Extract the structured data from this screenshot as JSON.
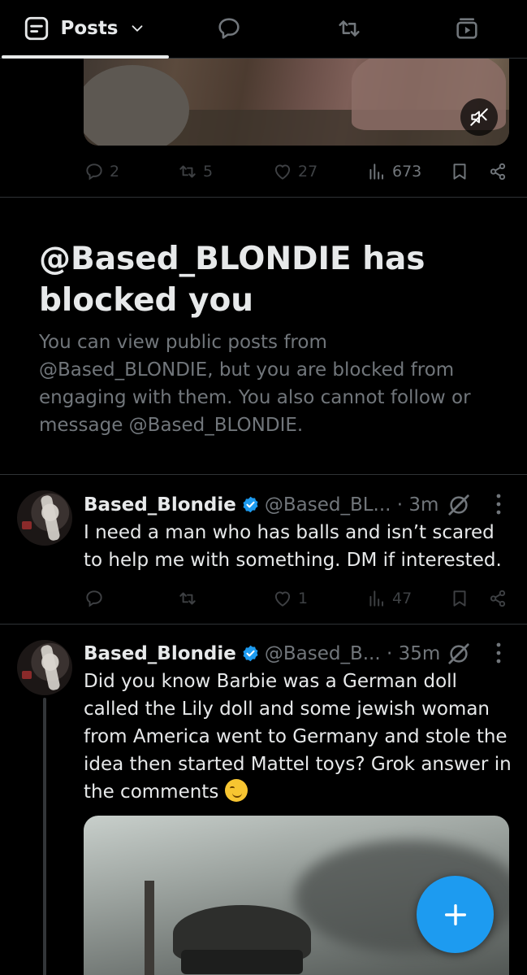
{
  "tabs": {
    "posts_label": "Posts",
    "icons": [
      "posts-list-icon",
      "chevron-down-icon",
      "replies-icon",
      "reposts-icon",
      "media-icon"
    ]
  },
  "previous_post": {
    "stats": {
      "replies": "2",
      "reposts": "5",
      "likes": "27",
      "views": "673"
    },
    "media": "video-muted"
  },
  "blocked_notice": {
    "title": "@Based_BLONDIE has blocked you",
    "body": "You can view public posts from @Based_BLONDIE, but you are blocked from engaging with them. You also cannot follow or message @Based_BLONDIE."
  },
  "posts": [
    {
      "name": "Based_Blondie",
      "handle": "@Based_BL...",
      "time": "· 3m",
      "text": "I need a man who has balls and isn’t scared to help me with something. DM if interested.",
      "stats": {
        "replies": "",
        "reposts": "",
        "likes": "1",
        "views": "47"
      }
    },
    {
      "name": "Based_Blondie",
      "handle": "@Based_B...",
      "time": "· 35m",
      "text": "Did you know Barbie was a German doll called the Lily doll and some jewish woman from America went to Germany and stole the idea then started Mattel toys? Grok answer in the comments",
      "emoji": "smirking-face"
    }
  ],
  "colors": {
    "background": "#000000",
    "text_primary": "#e7e9ea",
    "text_secondary": "#71767b",
    "accent": "#1d9bf0",
    "divider": "#2f3336"
  }
}
